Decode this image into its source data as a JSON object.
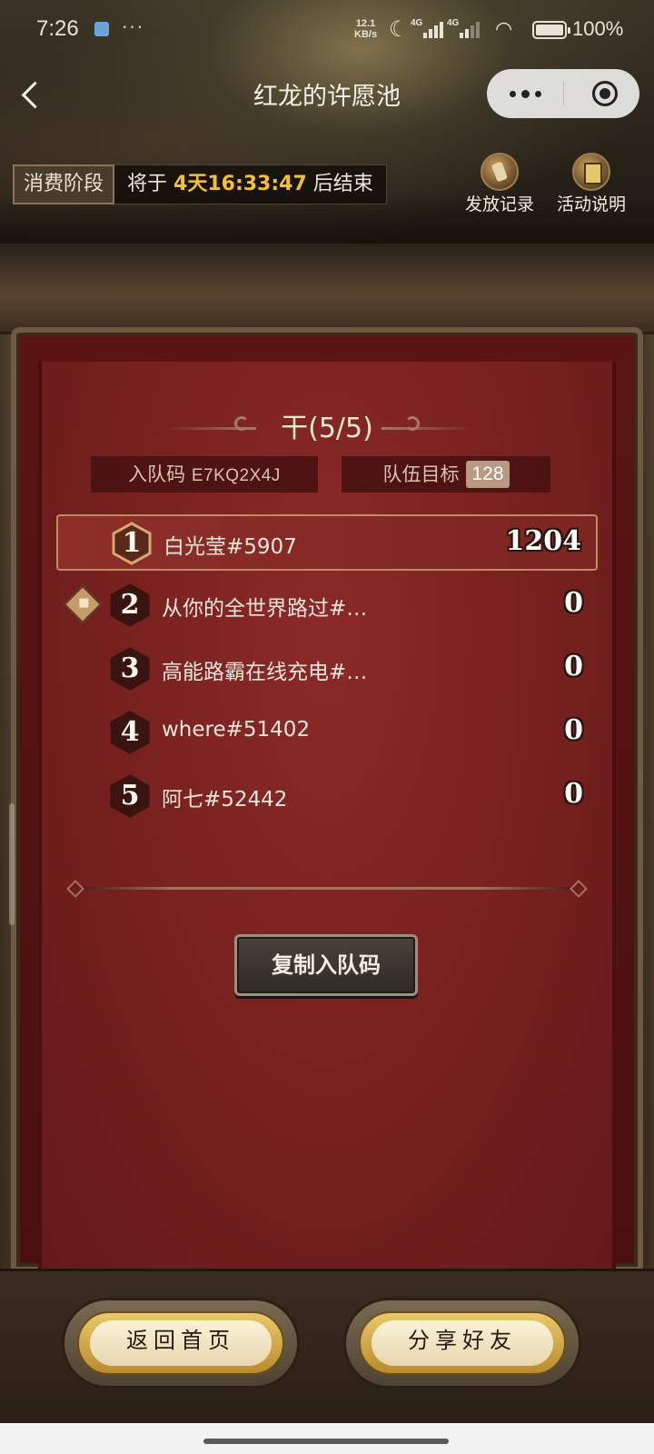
{
  "status_bar": {
    "time": "7:26",
    "net_speed_value": "12.1",
    "net_speed_unit": "KB/s",
    "network1": "4G",
    "network2": "4G",
    "battery": "100%"
  },
  "nav": {
    "title": "红龙的许愿池"
  },
  "phase": {
    "label": "消费阶段",
    "prefix": "将于",
    "countdown": "4天16:33:47",
    "suffix": "后结束"
  },
  "actions": {
    "records_label": "发放记录",
    "rules_label": "活动说明"
  },
  "team": {
    "title": "干(5/5)",
    "code_label": "入队码",
    "code": "E7KQ2X4J",
    "goal_label": "队伍目标",
    "goal": "128",
    "members": [
      {
        "rank": "1",
        "name": "白光莹#5907",
        "score": "1204"
      },
      {
        "rank": "2",
        "name": "从你的全世界路过#…",
        "score": "0"
      },
      {
        "rank": "3",
        "name": "高能路霸在线充电#…",
        "score": "0"
      },
      {
        "rank": "4",
        "name": "where#51402",
        "score": "0"
      },
      {
        "rank": "5",
        "name": "阿七#52442",
        "score": "0"
      }
    ],
    "copy_button": "复制入队码"
  },
  "bottom": {
    "home_label": "返回首页",
    "share_label": "分享好友"
  },
  "colors": {
    "accent": "#f3c032",
    "panel": "#7a2220",
    "button_gold": "#e9c96a"
  }
}
